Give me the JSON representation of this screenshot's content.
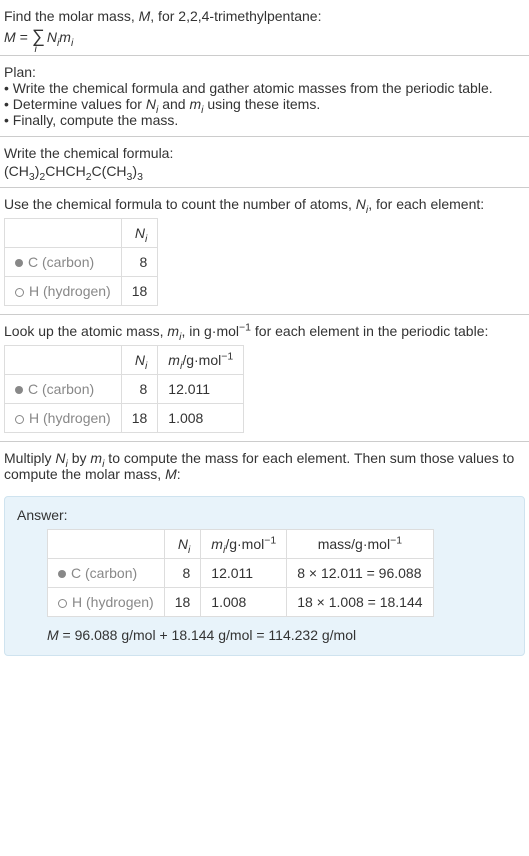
{
  "intro": {
    "line1_pre": "Find the molar mass, ",
    "line1_mid": ", for 2,2,4-trimethylpentane:",
    "M": "M"
  },
  "plan": {
    "heading": "Plan:",
    "bullet1_pre": "• Write the chemical formula and gather atomic masses from the periodic table.",
    "bullet2_pre": "• Determine values for ",
    "bullet2_mid": " and ",
    "bullet2_end": " using these items.",
    "Ni": "N",
    "Ni_sub": "i",
    "mi": "m",
    "mi_sub": "i",
    "bullet3": "• Finally, compute the mass."
  },
  "writeFormula": {
    "label": "Write the chemical formula:"
  },
  "countAtoms": {
    "label_pre": "Use the chemical formula to count the number of atoms, ",
    "label_end": ", for each element:",
    "headers": {
      "ni": "N",
      "ni_sub": "i"
    },
    "rows": [
      {
        "elem": "C",
        "ename": " (carbon)",
        "n": "8"
      },
      {
        "elem": "H",
        "ename": " (hydrogen)",
        "n": "18"
      }
    ]
  },
  "lookup": {
    "label_pre": "Look up the atomic mass, ",
    "label_mid": ", in g·mol",
    "label_exp": "−1",
    "label_end": " for each element in the periodic table:",
    "headers": {
      "ni": "N",
      "ni_sub": "i",
      "mi": "m",
      "mi_sub": "i",
      "unit_pre": "/g·mol",
      "unit_exp": "−1"
    },
    "rows": [
      {
        "elem": "C",
        "ename": " (carbon)",
        "n": "8",
        "m": "12.011"
      },
      {
        "elem": "H",
        "ename": " (hydrogen)",
        "n": "18",
        "m": "1.008"
      }
    ]
  },
  "multiply": {
    "text_pre": "Multiply ",
    "text_mid1": " by ",
    "text_mid2": " to compute the mass for each element. Then sum those values to compute the molar mass, ",
    "text_end": ":"
  },
  "answer": {
    "label": "Answer:",
    "headers": {
      "ni": "N",
      "ni_sub": "i",
      "mi": "m",
      "mi_sub": "i",
      "unit_pre": "/g·mol",
      "unit_exp": "−1",
      "mass_pre": "mass/g·mol"
    },
    "rows": [
      {
        "elem": "C",
        "ename": " (carbon)",
        "n": "8",
        "m": "12.011",
        "mass": "8 × 12.011 = 96.088"
      },
      {
        "elem": "H",
        "ename": " (hydrogen)",
        "n": "18",
        "m": "1.008",
        "mass": "18 × 1.008 = 18.144"
      }
    ],
    "final": " = 96.088 g/mol + 18.144 g/mol = 114.232 g/mol"
  }
}
